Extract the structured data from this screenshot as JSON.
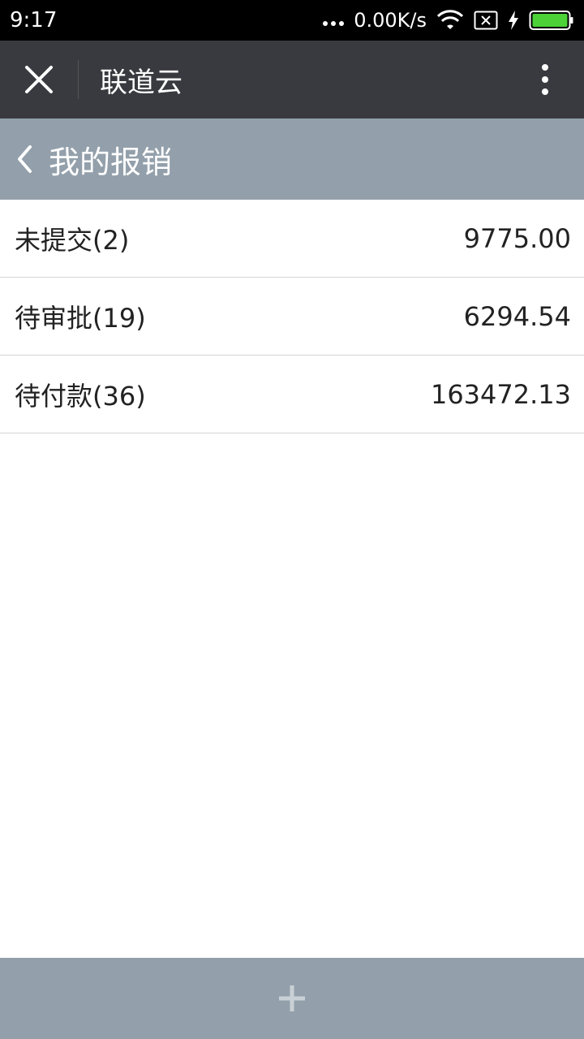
{
  "status_bar": {
    "time": "9:17",
    "network_speed": "0.00K/s",
    "icons": [
      "dots-icon",
      "wifi-icon",
      "sim-icon",
      "charging-icon",
      "battery-icon"
    ]
  },
  "app_bar": {
    "title": "联道云",
    "close_icon": "close-icon",
    "more_icon": "more-vertical-icon"
  },
  "header": {
    "title": "我的报销",
    "back_icon": "chevron-left-icon"
  },
  "list": [
    {
      "label": "未提交(2)",
      "amount": "9775.00"
    },
    {
      "label": "待审批(19)",
      "amount": "6294.54"
    },
    {
      "label": "待付款(36)",
      "amount": "163472.13"
    }
  ],
  "bottom_bar": {
    "add_icon": "plus-icon"
  },
  "colors": {
    "status_bar": "#000000",
    "app_bar": "#393a3f",
    "header": "#93a0ab",
    "bottom_bar": "#93a0ab",
    "battery": "#4cd137"
  }
}
